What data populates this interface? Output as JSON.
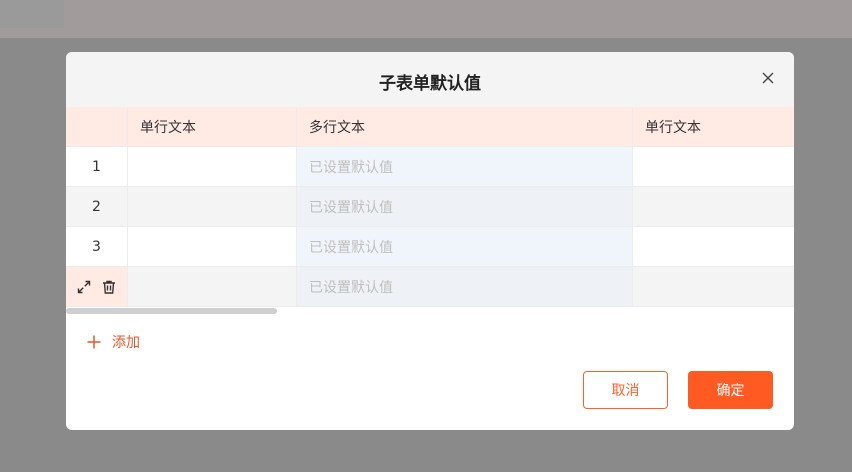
{
  "dialog": {
    "title": "子表单默认值",
    "add_label": "添加",
    "cancel_label": "取消",
    "confirm_label": "确定"
  },
  "table": {
    "columns": [
      "",
      "单行文本",
      "多行文本",
      "单行文本"
    ],
    "rows": [
      {
        "index": "1",
        "col1": "",
        "col2": "已设置默认值",
        "col3": ""
      },
      {
        "index": "2",
        "col1": "",
        "col2": "已设置默认值",
        "col3": ""
      },
      {
        "index": "3",
        "col1": "",
        "col2": "已设置默认值",
        "col3": ""
      },
      {
        "index": "",
        "col1": "",
        "col2": "已设置默认值",
        "col3": ""
      }
    ]
  },
  "colors": {
    "accent": "#ff5a22",
    "header_bg": "#ffebe4",
    "placeholder": "#bfbfbf"
  },
  "icons": [
    "close-icon",
    "expand-icon",
    "trash-icon",
    "plus-icon"
  ]
}
